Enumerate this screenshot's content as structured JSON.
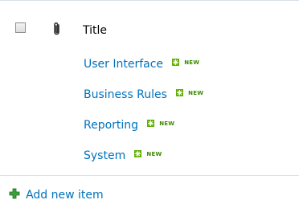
{
  "list": {
    "header": {
      "title_label": "Title"
    },
    "items": [
      {
        "label": "User Interface",
        "badge": "NEW"
      },
      {
        "label": "Business Rules",
        "badge": "NEW"
      },
      {
        "label": "Reporting",
        "badge": "NEW"
      },
      {
        "label": "System",
        "badge": "NEW"
      }
    ],
    "add_new_label": "Add new item"
  },
  "colors": {
    "link": "#0072bc",
    "new_badge": "#3b8a00",
    "add_icon": "#3ca03c"
  },
  "icons": {
    "select_all": "checkbox-icon",
    "attachment": "paperclip-icon",
    "new_item": "new-sparkle-icon",
    "add": "plus-icon"
  }
}
